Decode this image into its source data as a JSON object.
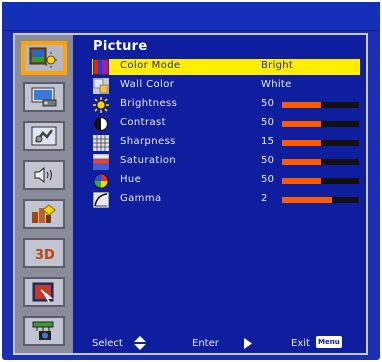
{
  "menu": {
    "title": "Picture",
    "items": [
      {
        "label": "Color Mode",
        "value": "Bright",
        "icon": "color-mode-icon",
        "selected": true
      },
      {
        "label": "Wall Color",
        "value": "White",
        "icon": "wall-color-icon",
        "selected": false
      },
      {
        "label": "Brightness",
        "value": "50",
        "icon": "brightness-icon",
        "level": 0.5
      },
      {
        "label": "Contrast",
        "value": "50",
        "icon": "contrast-icon",
        "level": 0.5
      },
      {
        "label": "Sharpness",
        "value": "15",
        "icon": "sharpness-icon",
        "level": 0.5
      },
      {
        "label": "Saturation",
        "value": "50",
        "icon": "saturation-icon",
        "level": 0.5
      },
      {
        "label": "Hue",
        "value": "50",
        "icon": "hue-icon",
        "level": 0.5
      },
      {
        "label": "Gamma",
        "value": "2",
        "icon": "gamma-icon",
        "level": 0.65
      }
    ]
  },
  "sidebar": {
    "items": [
      {
        "name": "picture-tab",
        "icon": "picture-icon",
        "active": true
      },
      {
        "name": "screen-tab",
        "icon": "screen-icon"
      },
      {
        "name": "setting-tab",
        "icon": "setting-icon"
      },
      {
        "name": "volume-tab",
        "icon": "volume-icon"
      },
      {
        "name": "options-tab",
        "icon": "options-icon"
      },
      {
        "name": "3d-tab",
        "icon": "3d-icon",
        "text": "3D"
      },
      {
        "name": "interactive-tab",
        "icon": "interactive-icon"
      },
      {
        "name": "lan-tab",
        "icon": "lan-icon"
      }
    ]
  },
  "footer": {
    "select_label": "Select",
    "enter_label": "Enter",
    "exit_label": "Exit",
    "menu_key": "Menu"
  },
  "colors": {
    "background_blue": "#1a2fb4",
    "highlight_yellow": "#ffee00",
    "bar_fill": "#ff5a00",
    "sidebar_gray": "#8a8c99",
    "active_border": "#ffa300"
  }
}
